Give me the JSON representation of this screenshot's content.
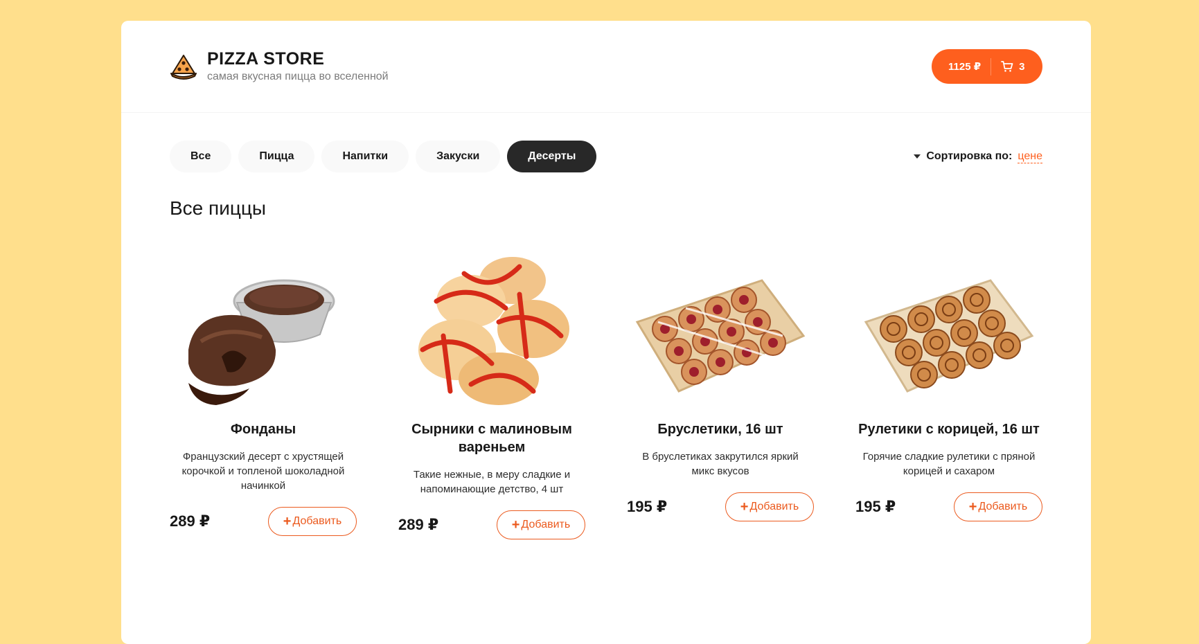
{
  "header": {
    "title": "PIZZA STORE",
    "subtitle": "самая вкусная пицца во вселенной",
    "logo_icon": "pizza-slice-icon",
    "cart": {
      "total": "1125 ₽",
      "count": "3",
      "icon": "cart-icon"
    }
  },
  "categories": [
    {
      "label": "Все",
      "active": false
    },
    {
      "label": "Пицца",
      "active": false
    },
    {
      "label": "Напитки",
      "active": false
    },
    {
      "label": "Закуски",
      "active": false
    },
    {
      "label": "Десерты",
      "active": true
    }
  ],
  "sort": {
    "label": "Сортировка по:",
    "value": "цене"
  },
  "section_title": "Все пиццы",
  "products": [
    {
      "name": "Фонданы",
      "description": "Французский десерт с хрустящей корочкой и топленой шоколадной начинкой",
      "price": "289 ₽",
      "add_label": "Добавить"
    },
    {
      "name": "Сырники с малиновым вареньем",
      "description": "Такие нежные, в меру сладкие и напоминающие детство, 4 шт",
      "price": "289 ₽",
      "add_label": "Добавить"
    },
    {
      "name": "Бруслетики, 16 шт",
      "description": "В бруслетиках закрутился яркий микс вкусов",
      "price": "195 ₽",
      "add_label": "Добавить"
    },
    {
      "name": "Рулетики с корицей, 16 шт",
      "description": "Горячие сладкие рулетики с пряной корицей и сахаром",
      "price": "195 ₽",
      "add_label": "Добавить"
    }
  ],
  "colors": {
    "accent": "#FE5F1E",
    "background": "#FFDF8C",
    "active_category": "#282828"
  }
}
